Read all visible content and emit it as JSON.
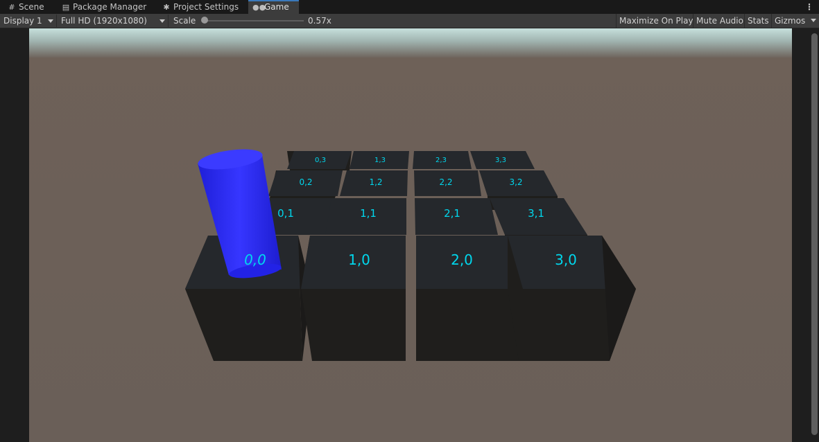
{
  "tabs": [
    {
      "label": "Scene",
      "icon": "grid-icon"
    },
    {
      "label": "Package Manager",
      "icon": "package-icon"
    },
    {
      "label": "Project Settings",
      "icon": "gear-icon"
    },
    {
      "label": "Game",
      "icon": "gamepad-icon",
      "active": true
    }
  ],
  "toolbar": {
    "display": "Display 1",
    "resolution": "Full HD (1920x1080)",
    "scale_label": "Scale",
    "scale_value": "0.57x",
    "scale_fraction": 0.05,
    "maximize": "Maximize On Play",
    "mute": "Mute Audio",
    "stats": "Stats",
    "gizmos": "Gizmos"
  },
  "scene": {
    "tiles": {
      "row0": [
        "0,0",
        "1,0",
        "2,0",
        "3,0"
      ],
      "row1": [
        "0,1",
        "1,1",
        "2,1",
        "3,1"
      ],
      "row2": [
        "0,2",
        "1,2",
        "2,2",
        "3,2"
      ],
      "row3": [
        "0,3",
        "1,3",
        "2,3",
        "3,3"
      ]
    },
    "colors": {
      "ground": "#6b6058",
      "sky": "#b9d3cd",
      "cube_top": "#25282c",
      "cube_side": "#1f1e1c",
      "label": "#00d8ee",
      "cylinder": "#2b2bff"
    }
  }
}
